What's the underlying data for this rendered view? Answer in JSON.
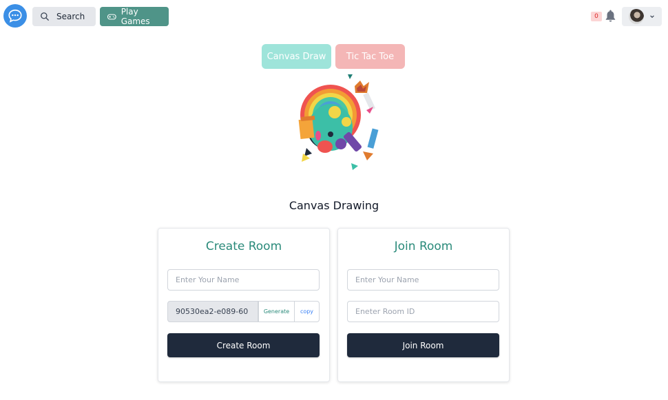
{
  "nav": {
    "search_label": "Search",
    "play_label": "Play Games",
    "notification_count": "0",
    "brand_color": "#3b8fe6",
    "accent_color": "#4f9488"
  },
  "tabs": [
    {
      "label": "Canvas Draw",
      "color": "#9ee4da"
    },
    {
      "label": "Tic Tac Toe",
      "color": "#f4b6b6"
    }
  ],
  "page": {
    "title": "Canvas Drawing"
  },
  "create_room": {
    "title": "Create Room",
    "name_placeholder": "Enter Your Name",
    "room_id_value": "90530ea2-e089-60",
    "generate_label": "Generate",
    "copy_label": "copy",
    "button_label": "Create Room"
  },
  "join_room": {
    "title": "Join Room",
    "name_placeholder": "Enter Your Name",
    "room_id_placeholder": "Eneter Room ID",
    "button_label": "Join Room"
  }
}
